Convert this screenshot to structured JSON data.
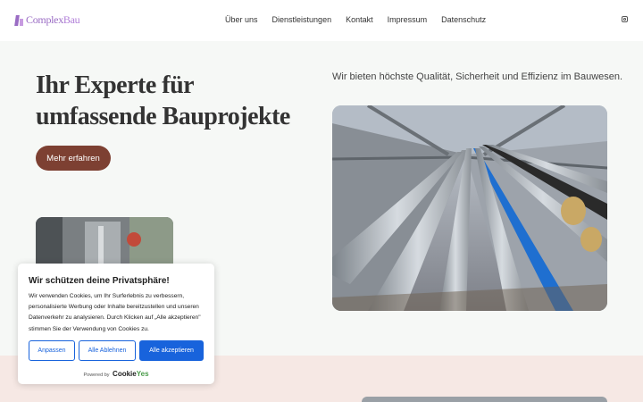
{
  "header": {
    "logo": {
      "part1": "Complex",
      "part2": "Bau"
    },
    "nav": [
      "Über uns",
      "Dienstleistungen",
      "Kontakt",
      "Impressum",
      "Datenschutz"
    ]
  },
  "hero": {
    "title_line1": "Ihr Experte für",
    "title_line2": "umfassende Bauprojekte",
    "subtitle": "Wir bieten höchste Qualität, Sicherheit und Effizienz im Bauwesen.",
    "cta_label": "Mehr erfahren"
  },
  "cookie": {
    "title": "Wir schützen deine Privatsphäre!",
    "text": "Wir verwenden Cookies, um Ihr Surferlebnis zu verbessern, personalisierte Werbung oder Inhalte bereitzustellen und unseren Datenverkehr zu analysieren. Durch Klicken auf „Alle akzeptieren\" stimmen Sie der Verwendung von Cookies zu.",
    "btn_customize": "Anpassen",
    "btn_reject": "Alle Ablehnen",
    "btn_accept": "Alle akzeptieren",
    "powered_by": "Powered by",
    "brand_part1": "Cookie",
    "brand_part2": "Yes"
  },
  "colors": {
    "accent": "#7d4032",
    "logo": "#9a6cc4",
    "cookie_blue": "#1863dc",
    "band": "#f6e8e4"
  },
  "icons": {
    "social": "instagram-icon"
  }
}
